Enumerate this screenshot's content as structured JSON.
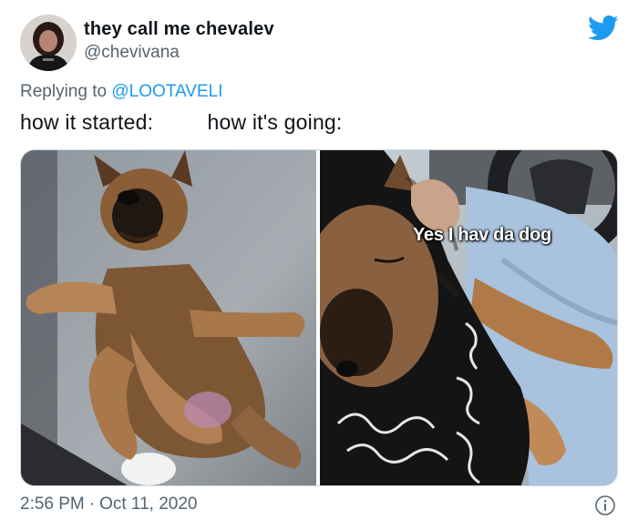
{
  "tweet": {
    "author": {
      "display_name": "they call me chevalev",
      "handle": "@chevivana",
      "avatar_icon": "user-avatar"
    },
    "brand_icon": "twitter-bird-icon",
    "brand_color": "#1d9bf0",
    "reply": {
      "prefix": "Replying to",
      "mention": "@LOOTAVELI"
    },
    "text": "how it started:         how it's going:",
    "media": {
      "left_image": "puppy-started-photo",
      "right_image": "puppy-going-photo",
      "right_caption": "Yes I hav da dog"
    },
    "time": "2:56 PM",
    "separator": "·",
    "date": "Oct 11, 2020",
    "info_icon": "info-icon"
  }
}
